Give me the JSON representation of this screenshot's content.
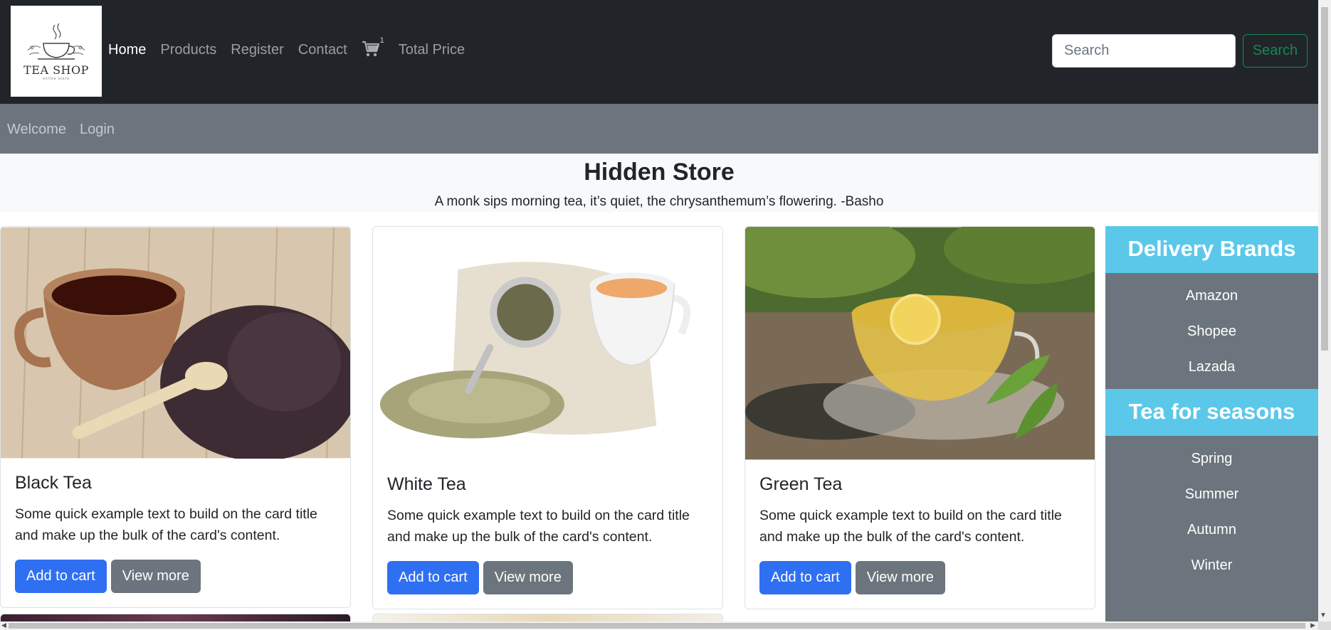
{
  "navbar": {
    "logo": {
      "text": "TEA SHOP",
      "subtext": "online store",
      "icon": "teacup-logo-icon"
    },
    "links": [
      "Home",
      "Products",
      "Register",
      "Contact"
    ],
    "cart": {
      "icon": "shopping-cart-icon",
      "count": "1"
    },
    "total_price_label": "Total Price",
    "search": {
      "placeholder": "Search",
      "button_label": "Search"
    }
  },
  "subnav": {
    "welcome": "Welcome",
    "login": "Login"
  },
  "hero": {
    "title": "Hidden Store",
    "quote": "A monk sips morning tea, it’s quiet, the chrysanthemum’s flowering. -Basho"
  },
  "cards": [
    {
      "title": "Black Tea",
      "text": "Some quick example text to build on the card title and make up the bulk of the card's content.",
      "add_label": "Add to cart",
      "view_label": "View more"
    },
    {
      "title": "White Tea",
      "text": "Some quick example text to build on the card title and make up the bulk of the card's content.",
      "add_label": "Add to cart",
      "view_label": "View more"
    },
    {
      "title": "Green Tea",
      "text": "Some quick example text to build on the card title and make up the bulk of the card's content.",
      "add_label": "Add to cart",
      "view_label": "View more"
    }
  ],
  "sidebar": {
    "delivery": {
      "title": "Delivery Brands",
      "items": [
        "Amazon",
        "Shopee",
        "Lazada"
      ]
    },
    "seasons": {
      "title": "Tea for seasons",
      "items": [
        "Spring",
        "Summer",
        "Autumn",
        "Winter"
      ]
    }
  },
  "colors": {
    "navbar_bg": "#212529",
    "subbar_bg": "#6c757d",
    "accent_cyan": "#5bc8ea",
    "primary": "#2f6ff2",
    "secondary": "#6c757d",
    "success": "#198754"
  }
}
